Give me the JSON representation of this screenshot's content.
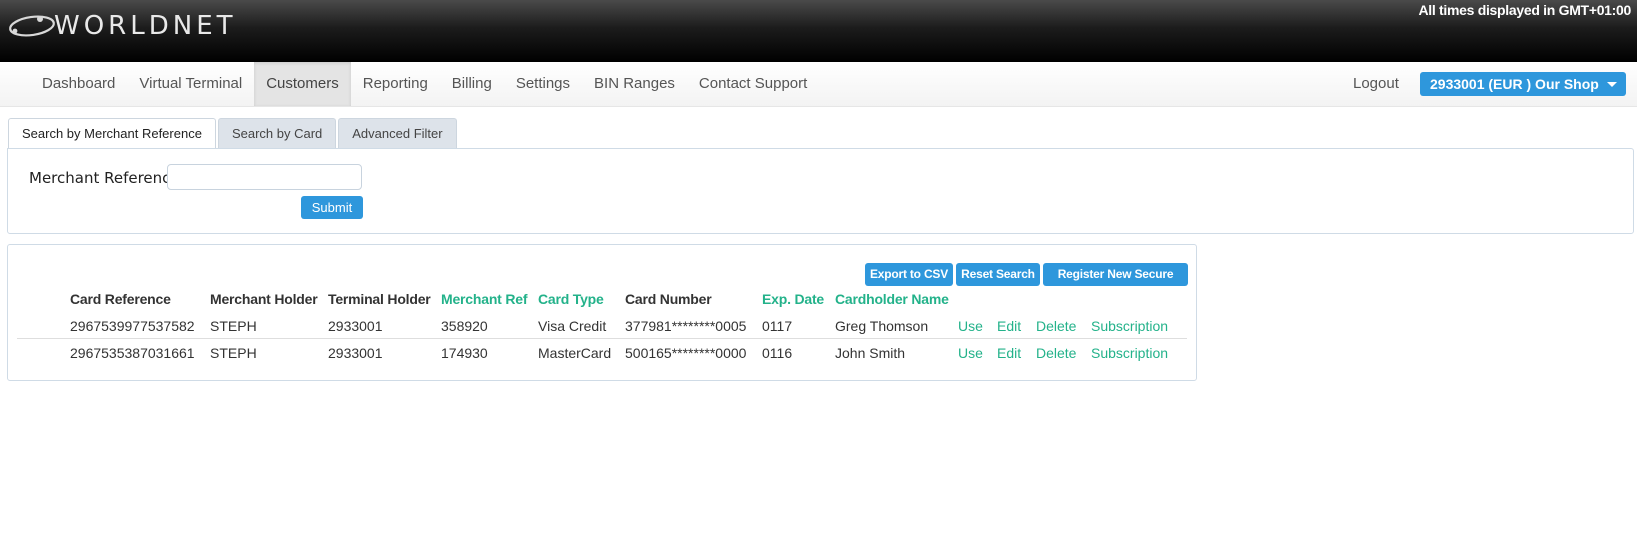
{
  "header": {
    "logo_text": "WORLDNET",
    "timezone_note": "All times displayed in GMT+01:00"
  },
  "nav": {
    "items": [
      "Dashboard",
      "Virtual Terminal",
      "Customers",
      "Reporting",
      "Billing",
      "Settings",
      "BIN Ranges",
      "Contact Support"
    ],
    "active": "Customers",
    "logout": "Logout",
    "terminal_select": "2933001 (EUR ) Our Shop"
  },
  "tabs": [
    "Search by Merchant Reference",
    "Search by Card",
    "Advanced Filter"
  ],
  "search": {
    "label": "Merchant Reference",
    "value": "",
    "submit": "Submit"
  },
  "results": {
    "buttons": {
      "export": "Export to CSV",
      "reset": "Reset Search",
      "register": "Register New Secure Card"
    },
    "columns": [
      "Card Reference",
      "Merchant Holder",
      "Terminal Holder",
      "Merchant Ref",
      "Card Type",
      "Card Number",
      "Exp. Date",
      "Cardholder Name"
    ],
    "actions": [
      "Use",
      "Edit",
      "Delete",
      "Subscription"
    ],
    "rows": [
      [
        "2967539977537582",
        "STEPH",
        "2933001",
        "358920",
        "Visa Credit",
        "377981********0005",
        "0117",
        "Greg Thomson"
      ],
      [
        "2967535387031661",
        "STEPH",
        "2933001",
        "174930",
        "MasterCard",
        "500165********0000",
        "0116",
        "John Smith"
      ]
    ]
  },
  "colors": {
    "primary": "#2e97dc",
    "link": "#23b28a"
  }
}
